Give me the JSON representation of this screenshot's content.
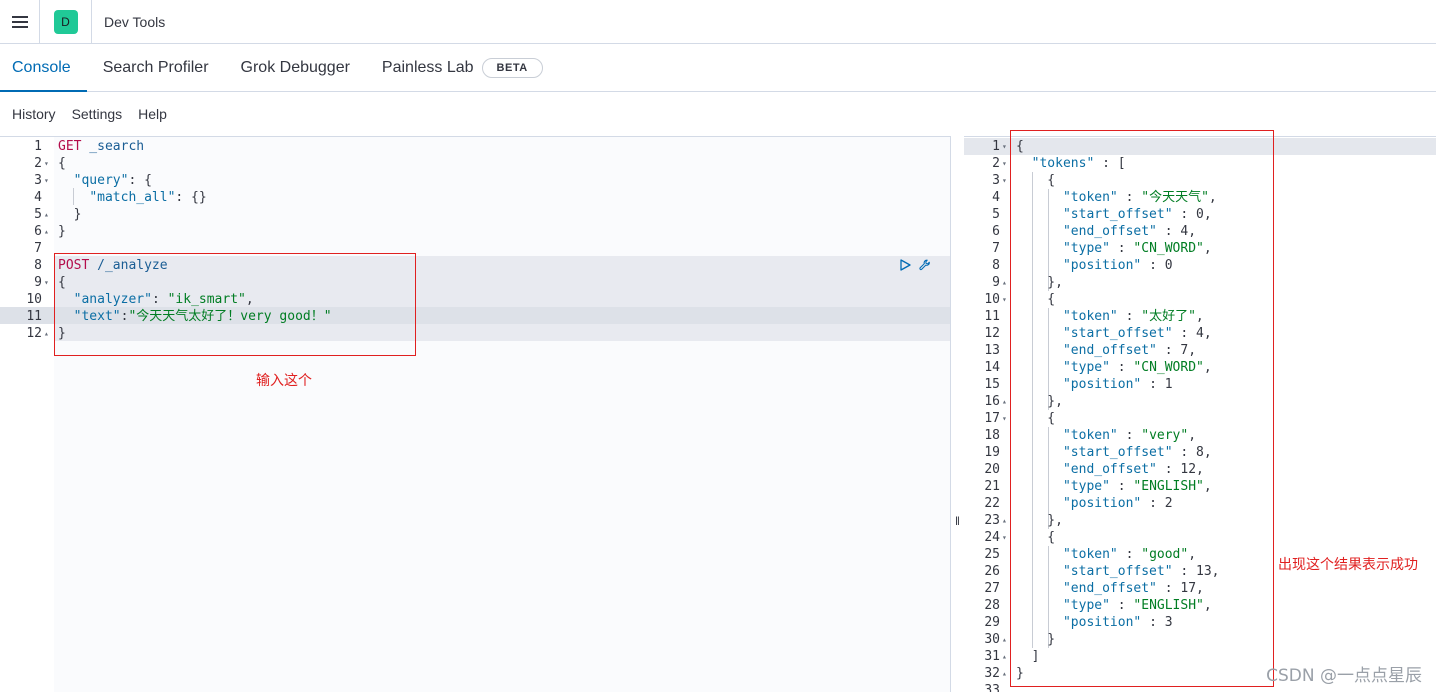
{
  "header": {
    "space_initial": "D",
    "app_title": "Dev Tools",
    "menu_icon": "hamburger-icon"
  },
  "tabs": [
    {
      "label": "Console",
      "active": true
    },
    {
      "label": "Search Profiler",
      "active": false
    },
    {
      "label": "Grok Debugger",
      "active": false
    },
    {
      "label": "Painless Lab",
      "active": false,
      "badge": "BETA"
    }
  ],
  "toolbar": {
    "history": "History",
    "settings": "Settings",
    "help": "Help"
  },
  "request_editor": {
    "lines": [
      {
        "n": "1",
        "fold": "",
        "parts": [
          {
            "c": "m",
            "t": "GET"
          },
          {
            "c": "u",
            "t": " _search"
          }
        ]
      },
      {
        "n": "2",
        "fold": "▾",
        "parts": [
          {
            "c": "p",
            "t": "{"
          }
        ]
      },
      {
        "n": "3",
        "fold": "▾",
        "parts": [
          {
            "c": "p",
            "t": "  "
          },
          {
            "c": "k",
            "t": "\"query\""
          },
          {
            "c": "p",
            "t": ": {"
          }
        ]
      },
      {
        "n": "4",
        "fold": "",
        "parts": [
          {
            "c": "p",
            "t": "    "
          },
          {
            "c": "k",
            "t": "\"match_all\""
          },
          {
            "c": "p",
            "t": ": {}"
          }
        ]
      },
      {
        "n": "5",
        "fold": "▴",
        "parts": [
          {
            "c": "p",
            "t": "  }"
          }
        ]
      },
      {
        "n": "6",
        "fold": "▴",
        "parts": [
          {
            "c": "p",
            "t": "}"
          }
        ]
      },
      {
        "n": "7",
        "fold": "",
        "parts": []
      },
      {
        "n": "8",
        "fold": "",
        "parts": [
          {
            "c": "m",
            "t": "POST"
          },
          {
            "c": "u",
            "t": " /_analyze"
          }
        ]
      },
      {
        "n": "9",
        "fold": "▾",
        "parts": [
          {
            "c": "p",
            "t": "{"
          }
        ]
      },
      {
        "n": "10",
        "fold": "",
        "parts": [
          {
            "c": "p",
            "t": "  "
          },
          {
            "c": "k",
            "t": "\"analyzer\""
          },
          {
            "c": "p",
            "t": ": "
          },
          {
            "c": "s",
            "t": "\"ik_smart\""
          },
          {
            "c": "p",
            "t": ","
          }
        ]
      },
      {
        "n": "11",
        "fold": "",
        "parts": [
          {
            "c": "p",
            "t": "  "
          },
          {
            "c": "k",
            "t": "\"text\""
          },
          {
            "c": "p",
            "t": ":"
          },
          {
            "c": "s",
            "t": "\"今天天气太好了！very good！\""
          }
        ]
      },
      {
        "n": "12",
        "fold": "▴",
        "parts": [
          {
            "c": "p",
            "t": "}"
          }
        ]
      }
    ],
    "annotation": "输入这个",
    "run_icon": "play-icon",
    "wrench_icon": "wrench-icon"
  },
  "response_editor": {
    "lines": [
      {
        "n": "1",
        "fold": "▾",
        "parts": [
          {
            "c": "p",
            "t": "{"
          }
        ]
      },
      {
        "n": "2",
        "fold": "▾",
        "parts": [
          {
            "c": "p",
            "t": "  "
          },
          {
            "c": "k",
            "t": "\"tokens\""
          },
          {
            "c": "p",
            "t": " : ["
          }
        ]
      },
      {
        "n": "3",
        "fold": "▾",
        "parts": [
          {
            "c": "p",
            "t": "    {"
          }
        ]
      },
      {
        "n": "4",
        "fold": "",
        "parts": [
          {
            "c": "p",
            "t": "      "
          },
          {
            "c": "k",
            "t": "\"token\""
          },
          {
            "c": "p",
            "t": " : "
          },
          {
            "c": "s",
            "t": "\"今天天气\""
          },
          {
            "c": "p",
            "t": ","
          }
        ]
      },
      {
        "n": "5",
        "fold": "",
        "parts": [
          {
            "c": "p",
            "t": "      "
          },
          {
            "c": "k",
            "t": "\"start_offset\""
          },
          {
            "c": "p",
            "t": " : 0,"
          }
        ]
      },
      {
        "n": "6",
        "fold": "",
        "parts": [
          {
            "c": "p",
            "t": "      "
          },
          {
            "c": "k",
            "t": "\"end_offset\""
          },
          {
            "c": "p",
            "t": " : 4,"
          }
        ]
      },
      {
        "n": "7",
        "fold": "",
        "parts": [
          {
            "c": "p",
            "t": "      "
          },
          {
            "c": "k",
            "t": "\"type\""
          },
          {
            "c": "p",
            "t": " : "
          },
          {
            "c": "s",
            "t": "\"CN_WORD\""
          },
          {
            "c": "p",
            "t": ","
          }
        ]
      },
      {
        "n": "8",
        "fold": "",
        "parts": [
          {
            "c": "p",
            "t": "      "
          },
          {
            "c": "k",
            "t": "\"position\""
          },
          {
            "c": "p",
            "t": " : 0"
          }
        ]
      },
      {
        "n": "9",
        "fold": "▴",
        "parts": [
          {
            "c": "p",
            "t": "    },"
          }
        ]
      },
      {
        "n": "10",
        "fold": "▾",
        "parts": [
          {
            "c": "p",
            "t": "    {"
          }
        ]
      },
      {
        "n": "11",
        "fold": "",
        "parts": [
          {
            "c": "p",
            "t": "      "
          },
          {
            "c": "k",
            "t": "\"token\""
          },
          {
            "c": "p",
            "t": " : "
          },
          {
            "c": "s",
            "t": "\"太好了\""
          },
          {
            "c": "p",
            "t": ","
          }
        ]
      },
      {
        "n": "12",
        "fold": "",
        "parts": [
          {
            "c": "p",
            "t": "      "
          },
          {
            "c": "k",
            "t": "\"start_offset\""
          },
          {
            "c": "p",
            "t": " : 4,"
          }
        ]
      },
      {
        "n": "13",
        "fold": "",
        "parts": [
          {
            "c": "p",
            "t": "      "
          },
          {
            "c": "k",
            "t": "\"end_offset\""
          },
          {
            "c": "p",
            "t": " : 7,"
          }
        ]
      },
      {
        "n": "14",
        "fold": "",
        "parts": [
          {
            "c": "p",
            "t": "      "
          },
          {
            "c": "k",
            "t": "\"type\""
          },
          {
            "c": "p",
            "t": " : "
          },
          {
            "c": "s",
            "t": "\"CN_WORD\""
          },
          {
            "c": "p",
            "t": ","
          }
        ]
      },
      {
        "n": "15",
        "fold": "",
        "parts": [
          {
            "c": "p",
            "t": "      "
          },
          {
            "c": "k",
            "t": "\"position\""
          },
          {
            "c": "p",
            "t": " : 1"
          }
        ]
      },
      {
        "n": "16",
        "fold": "▴",
        "parts": [
          {
            "c": "p",
            "t": "    },"
          }
        ]
      },
      {
        "n": "17",
        "fold": "▾",
        "parts": [
          {
            "c": "p",
            "t": "    {"
          }
        ]
      },
      {
        "n": "18",
        "fold": "",
        "parts": [
          {
            "c": "p",
            "t": "      "
          },
          {
            "c": "k",
            "t": "\"token\""
          },
          {
            "c": "p",
            "t": " : "
          },
          {
            "c": "s",
            "t": "\"very\""
          },
          {
            "c": "p",
            "t": ","
          }
        ]
      },
      {
        "n": "19",
        "fold": "",
        "parts": [
          {
            "c": "p",
            "t": "      "
          },
          {
            "c": "k",
            "t": "\"start_offset\""
          },
          {
            "c": "p",
            "t": " : 8,"
          }
        ]
      },
      {
        "n": "20",
        "fold": "",
        "parts": [
          {
            "c": "p",
            "t": "      "
          },
          {
            "c": "k",
            "t": "\"end_offset\""
          },
          {
            "c": "p",
            "t": " : 12,"
          }
        ]
      },
      {
        "n": "21",
        "fold": "",
        "parts": [
          {
            "c": "p",
            "t": "      "
          },
          {
            "c": "k",
            "t": "\"type\""
          },
          {
            "c": "p",
            "t": " : "
          },
          {
            "c": "s",
            "t": "\"ENGLISH\""
          },
          {
            "c": "p",
            "t": ","
          }
        ]
      },
      {
        "n": "22",
        "fold": "",
        "parts": [
          {
            "c": "p",
            "t": "      "
          },
          {
            "c": "k",
            "t": "\"position\""
          },
          {
            "c": "p",
            "t": " : 2"
          }
        ]
      },
      {
        "n": "23",
        "fold": "▴",
        "parts": [
          {
            "c": "p",
            "t": "    },"
          }
        ]
      },
      {
        "n": "24",
        "fold": "▾",
        "parts": [
          {
            "c": "p",
            "t": "    {"
          }
        ]
      },
      {
        "n": "25",
        "fold": "",
        "parts": [
          {
            "c": "p",
            "t": "      "
          },
          {
            "c": "k",
            "t": "\"token\""
          },
          {
            "c": "p",
            "t": " : "
          },
          {
            "c": "s",
            "t": "\"good\""
          },
          {
            "c": "p",
            "t": ","
          }
        ]
      },
      {
        "n": "26",
        "fold": "",
        "parts": [
          {
            "c": "p",
            "t": "      "
          },
          {
            "c": "k",
            "t": "\"start_offset\""
          },
          {
            "c": "p",
            "t": " : 13,"
          }
        ]
      },
      {
        "n": "27",
        "fold": "",
        "parts": [
          {
            "c": "p",
            "t": "      "
          },
          {
            "c": "k",
            "t": "\"end_offset\""
          },
          {
            "c": "p",
            "t": " : 17,"
          }
        ]
      },
      {
        "n": "28",
        "fold": "",
        "parts": [
          {
            "c": "p",
            "t": "      "
          },
          {
            "c": "k",
            "t": "\"type\""
          },
          {
            "c": "p",
            "t": " : "
          },
          {
            "c": "s",
            "t": "\"ENGLISH\""
          },
          {
            "c": "p",
            "t": ","
          }
        ]
      },
      {
        "n": "29",
        "fold": "",
        "parts": [
          {
            "c": "p",
            "t": "      "
          },
          {
            "c": "k",
            "t": "\"position\""
          },
          {
            "c": "p",
            "t": " : 3"
          }
        ]
      },
      {
        "n": "30",
        "fold": "▴",
        "parts": [
          {
            "c": "p",
            "t": "    }"
          }
        ]
      },
      {
        "n": "31",
        "fold": "▴",
        "parts": [
          {
            "c": "p",
            "t": "  ]"
          }
        ]
      },
      {
        "n": "32",
        "fold": "▴",
        "parts": [
          {
            "c": "p",
            "t": "}"
          }
        ]
      },
      {
        "n": "33",
        "fold": "",
        "parts": []
      }
    ],
    "annotation": "出现这个结果表示成功"
  },
  "resizer_glyph": "‖",
  "watermark": "CSDN @一点点星辰",
  "colors": {
    "accent": "#006bb4",
    "annotation": "#e02020",
    "method": "#b40d4b",
    "key": "#0b6ea4",
    "string": "#017d23"
  }
}
